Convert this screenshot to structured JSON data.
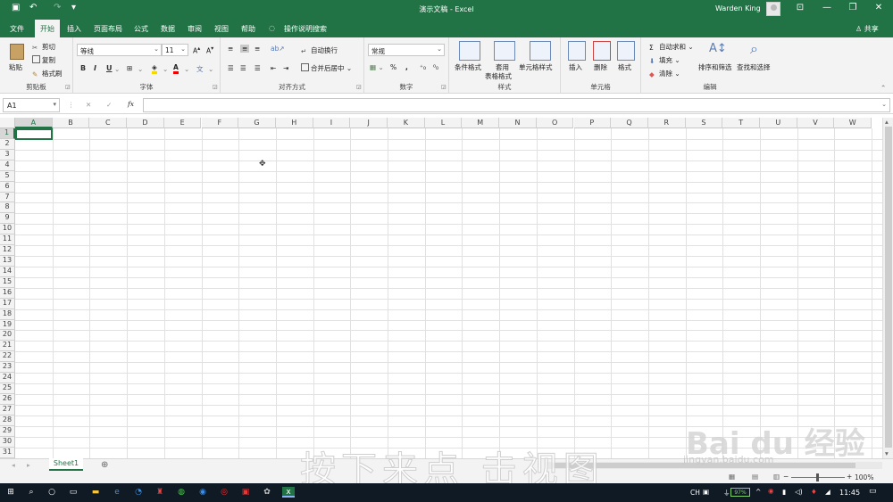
{
  "titlebar": {
    "title": "演示文稿 - Excel",
    "user": "Warden King",
    "save_icon": "▣",
    "undo_icon": "↶",
    "redo_icon": "↷",
    "customize_icon": "▾",
    "ribbon_options_icon": "⊡",
    "minimize_icon": "—",
    "restore_icon": "❐",
    "close_icon": "✕"
  },
  "tabs": {
    "file": "文件",
    "home": "开始",
    "insert": "插入",
    "page_layout": "页面布局",
    "formulas": "公式",
    "data": "数据",
    "review": "审阅",
    "view": "视图",
    "help": "帮助",
    "tell_me": "操作说明搜索",
    "share": "共享"
  },
  "ribbon": {
    "clipboard": {
      "label": "剪贴板",
      "paste": "粘贴",
      "cut": "剪切",
      "copy": "复制",
      "format_painter": "格式刷"
    },
    "font": {
      "label": "字体",
      "font_name": "等线",
      "font_size": "11",
      "bold": "B",
      "italic": "I",
      "underline": "U"
    },
    "alignment": {
      "label": "对齐方式",
      "wrap_text": "自动换行",
      "merge_center": "合并后居中"
    },
    "number": {
      "label": "数字",
      "format": "常规",
      "percent": "%",
      "comma": ","
    },
    "styles": {
      "label": "样式",
      "conditional_format": "条件格式",
      "format_as_table_1": "套用",
      "format_as_table_2": "表格格式",
      "cell_styles": "单元格样式"
    },
    "cells": {
      "label": "单元格",
      "insert": "插入",
      "delete": "删除",
      "format": "格式"
    },
    "editing": {
      "label": "编辑",
      "autosum": "自动求和",
      "fill": "填充",
      "clear": "清除",
      "sort_filter": "排序和筛选",
      "find_select": "查找和选择"
    }
  },
  "formula_bar": {
    "name_box": "A1",
    "fx": "fx",
    "cancel": "✕",
    "enter": "✓",
    "value": ""
  },
  "grid": {
    "columns": [
      "A",
      "B",
      "C",
      "D",
      "E",
      "F",
      "G",
      "H",
      "I",
      "J",
      "K",
      "L",
      "M",
      "N",
      "O",
      "P",
      "Q",
      "R",
      "S",
      "T",
      "U",
      "V",
      "W"
    ],
    "rows": [
      "1",
      "2",
      "3",
      "4",
      "5",
      "6",
      "7",
      "8",
      "9",
      "10",
      "11",
      "12",
      "13",
      "14",
      "15",
      "16",
      "17",
      "18",
      "19",
      "20",
      "21",
      "22",
      "23",
      "24",
      "25",
      "26",
      "27",
      "28",
      "29",
      "30",
      "31"
    ],
    "selected_cell": "A1"
  },
  "sheets": {
    "active": "Sheet1",
    "add_icon": "⊕"
  },
  "status": {
    "zoom": "100%",
    "zoom_minus": "−",
    "zoom_plus": "+"
  },
  "taskbar": {
    "clock": "11:45",
    "battery": "97%",
    "ime": "CH",
    "accent_color": "#217346"
  },
  "watermark": {
    "text": "按下来点 击视图",
    "brand": "Bai du 经验",
    "url": "jingyan.baidu.com"
  }
}
